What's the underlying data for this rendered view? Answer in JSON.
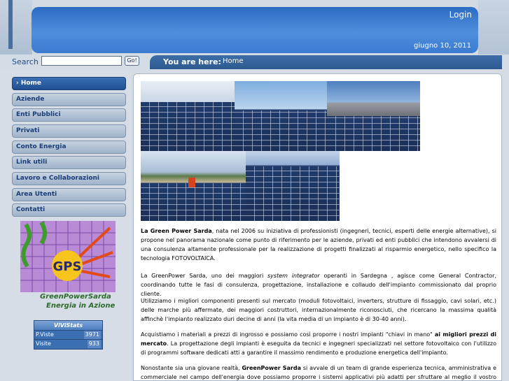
{
  "header": {
    "login_label": "Login",
    "date": "giugno 10, 2011"
  },
  "search": {
    "label": "Search",
    "placeholder": "",
    "go_label": "Go!"
  },
  "breadcrumb": {
    "prefix": "You are here:",
    "current": "Home"
  },
  "sidebar": {
    "items": [
      {
        "label": "Home",
        "active": true
      },
      {
        "label": "Aziende"
      },
      {
        "label": "Enti Pubblici"
      },
      {
        "label": "Privati"
      },
      {
        "label": "Conto Energia"
      },
      {
        "label": "Link utili"
      },
      {
        "label": "Lavoro e Collaborazioni"
      },
      {
        "label": "Area Utenti"
      },
      {
        "label": "Contatti"
      }
    ],
    "logo_text": "GPS",
    "caption_line1": "GreenPowerSarda",
    "caption_line2": "Energia in Azione",
    "stats": {
      "title": "ViViStats",
      "rows": [
        {
          "label": "P.Viste",
          "value": "3971"
        },
        {
          "label": "Visite",
          "value": "933"
        }
      ]
    }
  },
  "content": {
    "p1_bold": "La Green Power Sarda",
    "p1_rest": ", nata nel 2006 su iniziativa di professionisti (ingegneri, tecnici, esperti delle energie alternative), si propone nel panorama nazionale come punto di riferimento per le aziende, privati ed enti pubblici che intendono avvalersi di una consulenza altamente professionale per la realizzazione di progetti finalizzati al risparmio energetico, nello specifico la tecnologia FOTOVOLTAICA.",
    "p2_start": "La GreenPower Sarda, uno dei maggiori ",
    "p2_italic": "system integrator",
    "p2_rest": " operanti in Sardegna , agisce come General Contractor, coordinando tutte le fasi di consulenza, progettazione, installazione e collaudo dell'impianto commissionato dal proprio cliente.",
    "p3": "Utilizziamo i migliori componenti presenti sul mercato (moduli fotovoltaici, inverters, strutture di fissaggio, cavi solari, etc.) delle marche più affermate, dei maggiori costruttori, internazionalmente riconosciuti, che ricercano la massima qualità affinchè l'impianto realizzato duri decine di anni (la vita media di un impianto è di 30-40 anni).",
    "p4_start": "Acquistiamo i materiali a prezzi di ingrosso e possiamo così proporre i nostri impianti \"chiavi in mano\" ",
    "p4_bold": "ai migliori prezzi di mercato",
    "p4_rest": ". La progettazione degli impianti è eseguita da tecnici e ingegneri specializzati nel settore fotovoltaico con l'utilizzo di programmi software dedicati atti a garantire il massimo rendimento e produzione energetica dell'impianto.",
    "p5_start": "Nonostante sia una giovane realtà, ",
    "p5_bold": "GreenPower Sarda",
    "p5_rest": " si avvale di un team di grande esperienza tecnica, amministrativa e commerciale nel campo dell'energia dove possiamo proporre i sistemi applicativi più adatti per sfruttare al meglio il vostro impianto"
  },
  "colors": {
    "header_blue": "#3b7ad0",
    "nav_active": "#1f4f92",
    "caption_green": "#2c6a2c"
  }
}
